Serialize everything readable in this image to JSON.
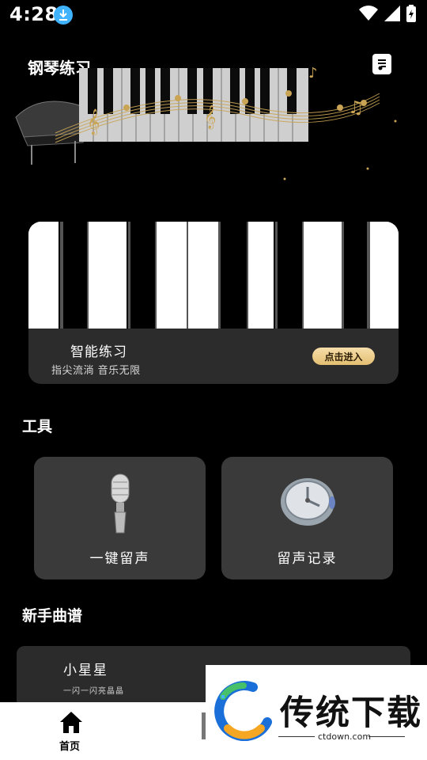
{
  "status_bar": {
    "time": "4:28"
  },
  "header": {
    "title": "钢琴练习"
  },
  "practice_card": {
    "title": "智能练习",
    "subtitle": "指尖流淌 音乐无限",
    "enter_label": "点击进入"
  },
  "tools": {
    "section_title": "工具",
    "items": [
      {
        "label": "一键留声",
        "icon": "microphone-icon"
      },
      {
        "label": "留声记录",
        "icon": "clock-icon"
      }
    ]
  },
  "songs": {
    "section_title": "新手曲谱",
    "items": [
      {
        "title": "小星星",
        "subtitle": "一闪一闪亮晶晶"
      }
    ]
  },
  "bottom_nav": {
    "items": [
      {
        "label": "首页",
        "icon": "home-icon"
      }
    ]
  },
  "watermark": {
    "text": "传统下载",
    "url": "ctdown.com"
  },
  "colors": {
    "accent_gold": "#e9c57a",
    "card_bg": "#3a3a3a",
    "download_badge": "#3fb3ff"
  }
}
